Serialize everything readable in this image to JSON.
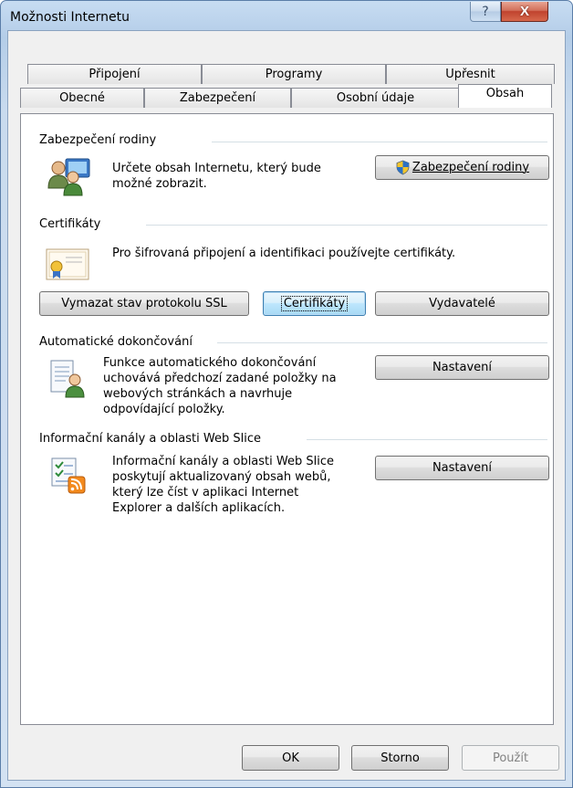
{
  "window": {
    "title": "Možnosti Internetu",
    "help_glyph": "?",
    "close_glyph": "X"
  },
  "tabs": {
    "row1": [
      "Připojení",
      "Programy",
      "Upřesnit"
    ],
    "row2": [
      "Obecné",
      "Zabezpečení",
      "Osobní údaje",
      "Obsah"
    ],
    "active": "Obsah"
  },
  "family_safety": {
    "title": "Zabezpečení rodiny",
    "description_line1": "Určete obsah Internetu, který bude",
    "description_line2": "možné zobrazit.",
    "button_label": "Zabezpečení rodiny"
  },
  "certificates": {
    "title": "Certifikáty",
    "description": "Pro šifrovaná připojení a identifikaci používejte certifikáty.",
    "clear_ssl_label": "Vymazat stav protokolu SSL",
    "certificates_label": "Certifikáty",
    "publishers_label": "Vydavatelé"
  },
  "autocomplete": {
    "title": "Automatické dokončování",
    "description_lines": [
      "Funkce automatického dokončování",
      "uchovává předchozí zadané položky na",
      "webových stránkách a navrhuje",
      "odpovídající položky."
    ],
    "settings_label": "Nastavení"
  },
  "feeds": {
    "title": "Informační kanály a oblasti Web Slice",
    "description_lines": [
      "Informační kanály a oblasti Web Slice",
      "poskytují aktualizovaný obsah webů,",
      "který lze číst v aplikaci Internet",
      "Explorer a dalších aplikacích."
    ],
    "settings_label": "Nastavení"
  },
  "footer": {
    "ok_label": "OK",
    "cancel_label": "Storno",
    "apply_label": "Použít"
  }
}
